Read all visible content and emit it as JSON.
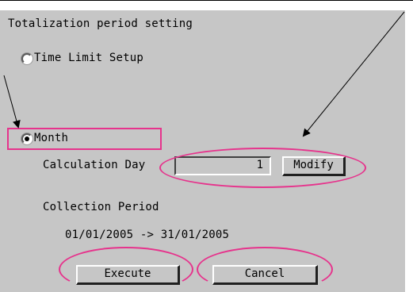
{
  "dialog": {
    "title": "Totalization period setting"
  },
  "options": {
    "time_limit_label": "Time Limit Setup",
    "time_limit_selected": false,
    "month_label": "Month",
    "month_selected": true
  },
  "calculation": {
    "label": "Calculation Day",
    "value": "1",
    "modify_label": "Modify"
  },
  "collection": {
    "label": "Collection Period",
    "range": "01/01/2005 -> 31/01/2005"
  },
  "actions": {
    "execute_label": "Execute",
    "cancel_label": "Cancel"
  },
  "annotation": {
    "highlight_color": "#e6338c",
    "panel_color": "#c6c6c6"
  }
}
